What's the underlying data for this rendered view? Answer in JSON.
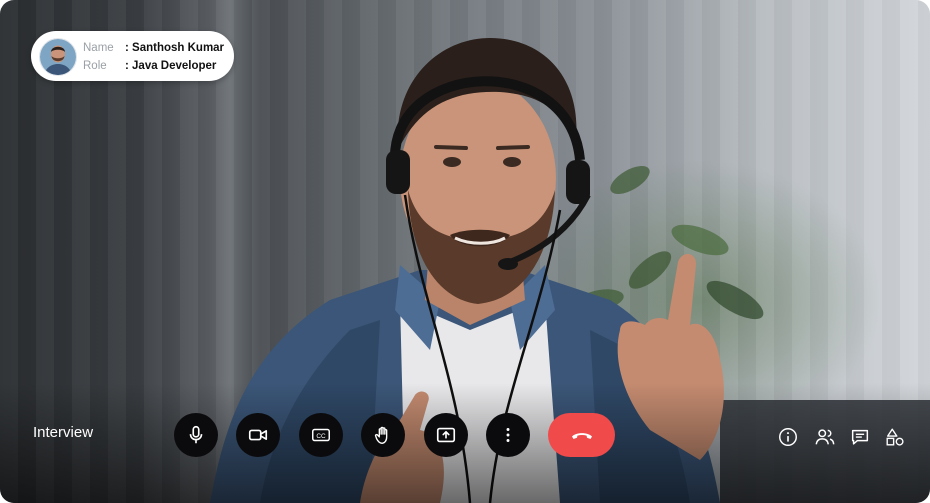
{
  "participant": {
    "name_label": "Name",
    "name_value": ": Santhosh Kumar",
    "role_label": "Role",
    "role_value": ": Java Developer"
  },
  "meeting": {
    "title": "Interview"
  },
  "controls": [
    {
      "name": "microphone",
      "icon": "microphone-icon"
    },
    {
      "name": "camera",
      "icon": "video-camera-icon"
    },
    {
      "name": "captions",
      "icon": "closed-captions-icon"
    },
    {
      "name": "raise-hand",
      "icon": "hand-icon"
    },
    {
      "name": "share-screen",
      "icon": "screen-share-icon"
    },
    {
      "name": "more-options",
      "icon": "more-vertical-icon"
    },
    {
      "name": "end-call",
      "icon": "phone-hangup-icon"
    }
  ],
  "side_actions": [
    {
      "name": "info",
      "icon": "info-icon"
    },
    {
      "name": "participants",
      "icon": "people-icon"
    },
    {
      "name": "chat",
      "icon": "chat-icon"
    },
    {
      "name": "activities",
      "icon": "shapes-icon"
    }
  ],
  "colors": {
    "end_call": "#f04a4a",
    "control_bg": "#0b0b0d",
    "pill_bg": "#ffffff"
  }
}
